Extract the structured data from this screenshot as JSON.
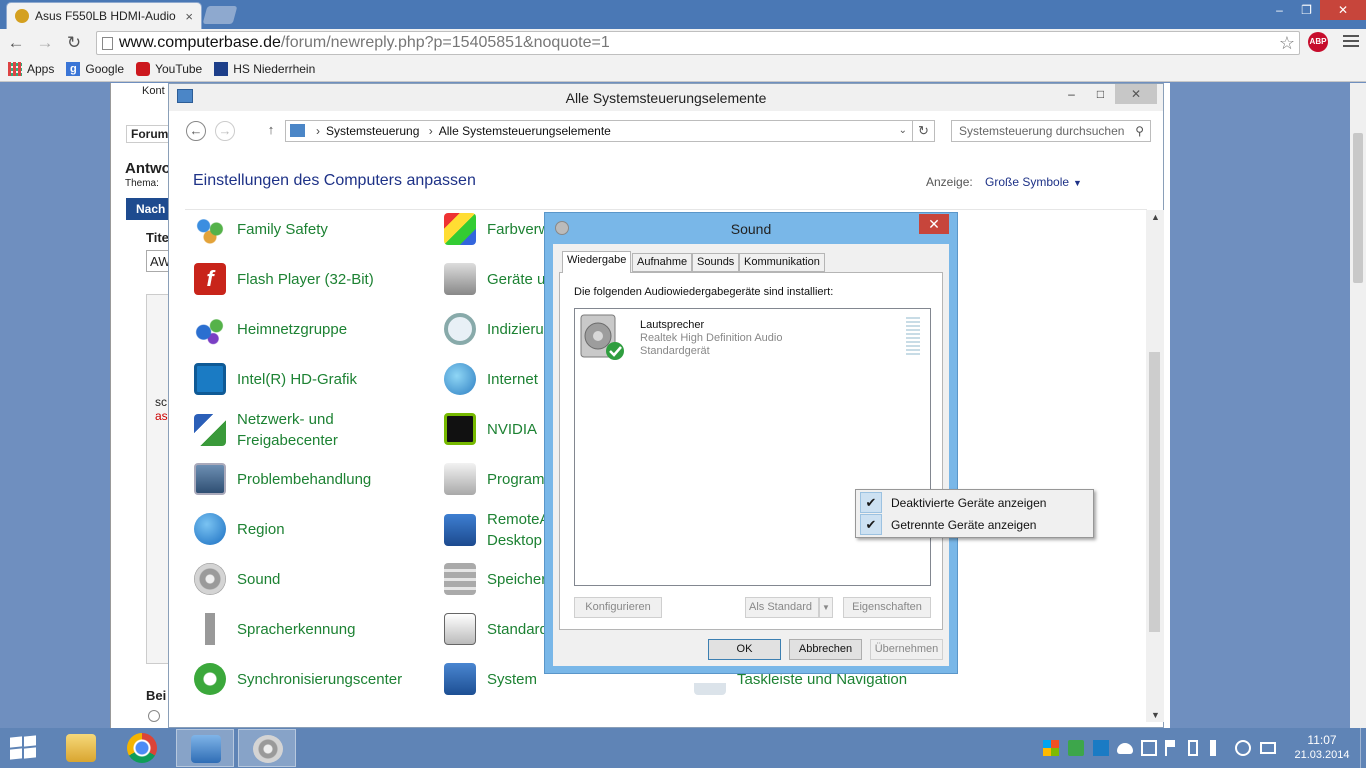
{
  "browser": {
    "tab_title": "Asus F550LB HDMI-Audio",
    "url_host": "www.computerbase.de",
    "url_path": "/forum/newreply.php?p=15405851&noquote=1",
    "abp_badge": "ABP",
    "bookmarks": [
      {
        "label": "Apps",
        "icon": "apps-grid-icon"
      },
      {
        "label": "Google",
        "icon": "google-icon"
      },
      {
        "label": "YouTube",
        "icon": "youtube-icon"
      },
      {
        "label": "HS Niederrhein",
        "icon": "hs-niederrhein-icon"
      }
    ]
  },
  "webpage_peek": {
    "kont": "Kont",
    "forum": "Forum",
    "antw": "Antwo",
    "thema": "Thema:",
    "nach": "Nach",
    "tite": "Tite",
    "aw": "AW",
    "sc": "sc",
    "as": "as",
    "bei": "Bei"
  },
  "control_panel": {
    "window_title": "Alle Systemsteuerungselemente",
    "breadcrumb": [
      "Systemsteuerung",
      "Alle Systemsteuerungselemente"
    ],
    "search_placeholder": "Systemsteuerung durchsuchen",
    "heading": "Einstellungen des Computers anpassen",
    "view_label": "Anzeige:",
    "view_value": "Große Symbole",
    "column1": [
      "Family Safety",
      "Flash Player (32-Bit)",
      "Heimnetzgruppe",
      "Intel(R) HD-Grafik",
      "Netzwerk- und Freigabecenter",
      "Problembehandlung",
      "Region",
      "Sound",
      "Spracherkennung",
      "Synchronisierungscenter"
    ],
    "column2": [
      "Farbverw",
      "Geräte u",
      "Indizieru",
      "Internet",
      "NVIDIA",
      "Program",
      "RemoteA Desktop",
      "Speicher",
      "Standard",
      "System"
    ],
    "column3_visible": "Taskleiste und Navigation"
  },
  "sound_dialog": {
    "title": "Sound",
    "tabs": [
      "Wiedergabe",
      "Aufnahme",
      "Sounds",
      "Kommunikation"
    ],
    "active_tab": "Wiedergabe",
    "panel_text": "Die folgenden Audiowiedergabegeräte sind installiert:",
    "device": {
      "name": "Lautsprecher",
      "driver": "Realtek High Definition Audio",
      "status": "Standardgerät"
    },
    "buttons": {
      "configure": "Konfigurieren",
      "set_default": "Als Standard",
      "properties": "Eigenschaften",
      "ok": "OK",
      "cancel": "Abbrechen",
      "apply": "Übernehmen"
    }
  },
  "context_menu": {
    "items": [
      {
        "label": "Deaktivierte Geräte anzeigen",
        "checked": true
      },
      {
        "label": "Getrennte Geräte anzeigen",
        "checked": true
      }
    ]
  },
  "taskbar": {
    "time": "11:07",
    "date": "21.03.2014",
    "pinned": [
      "file-explorer-icon",
      "chrome-icon",
      "control-panel-icon",
      "sound-icon"
    ]
  },
  "colors": {
    "cp_link_green": "#1d8233",
    "cp_heading_blue": "#1e3287",
    "dialog_frame": "#79b7e8",
    "taskbar": "#5f84b6"
  }
}
